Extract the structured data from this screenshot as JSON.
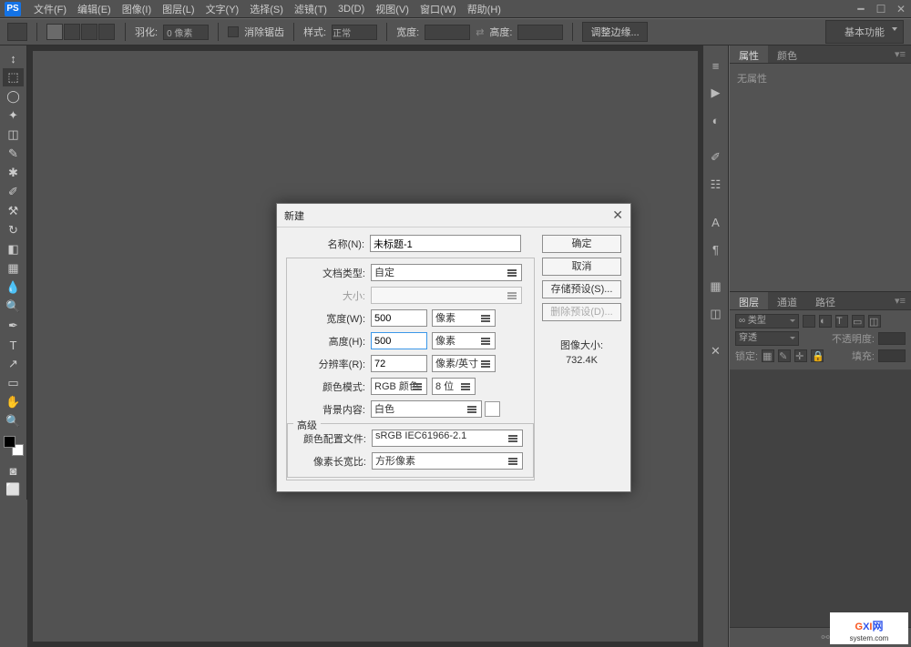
{
  "menu": [
    "文件(F)",
    "编辑(E)",
    "图像(I)",
    "图层(L)",
    "文字(Y)",
    "选择(S)",
    "滤镜(T)",
    "3D(D)",
    "视图(V)",
    "窗口(W)",
    "帮助(H)"
  ],
  "opts": {
    "feather_label": "羽化:",
    "feather_val": "0 像素",
    "antialias": "消除锯齿",
    "style_label": "样式:",
    "style_val": "正常",
    "width_label": "宽度:",
    "height_label": "高度:",
    "refine": "调整边缘...",
    "essentials": "基本功能"
  },
  "rpanel": {
    "prop_tab": "属性",
    "color_tab": "颜色",
    "noprops": "无属性",
    "layers_tab": "图层",
    "channels_tab": "通道",
    "paths_tab": "路径",
    "kind": "∞ 类型",
    "blend": "穿透",
    "opacity_lbl": "不透明度:",
    "lock_lbl": "锁定:",
    "fill_lbl": "填充:"
  },
  "dialog": {
    "title": "新建",
    "name_lbl": "名称(N):",
    "name_val": "未标题-1",
    "preset_lbl": "文档类型:",
    "preset_val": "自定",
    "size_lbl": "大小:",
    "width_lbl": "宽度(W):",
    "width_val": "500",
    "width_unit": "像素",
    "height_lbl": "高度(H):",
    "height_val": "500",
    "height_unit": "像素",
    "res_lbl": "分辨率(R):",
    "res_val": "72",
    "res_unit": "像素/英寸",
    "mode_lbl": "颜色模式:",
    "mode_val": "RGB 颜色",
    "depth": "8 位",
    "bg_lbl": "背景内容:",
    "bg_val": "白色",
    "adv": "高级",
    "profile_lbl": "颜色配置文件:",
    "profile_val": "sRGB IEC61966-2.1",
    "aspect_lbl": "像素长宽比:",
    "aspect_val": "方形像素",
    "ok": "确定",
    "cancel": "取消",
    "save_preset": "存储预设(S)...",
    "del_preset": "删除预设(D)...",
    "imgsize_lbl": "图像大小:",
    "imgsize_val": "732.4K"
  },
  "wm": {
    "a": "G",
    "b": "X",
    "c": "I",
    "d": "网",
    "sub": "system.com"
  }
}
